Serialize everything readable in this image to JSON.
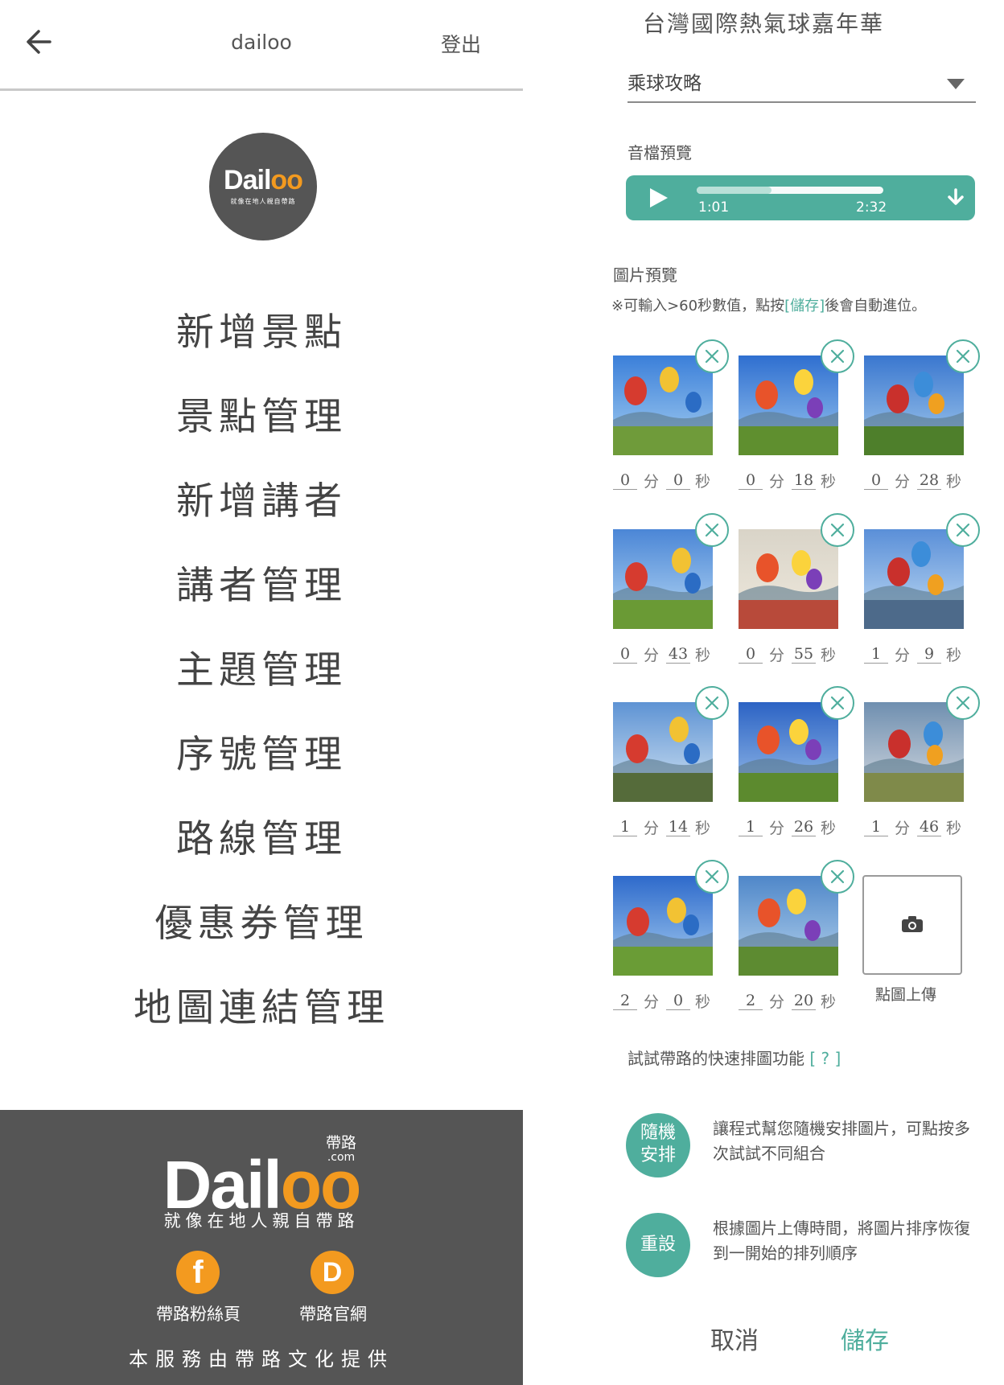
{
  "left_panel": {
    "title": "dailoo",
    "logout_label": "登出",
    "logo": {
      "brand_prefix": "Dail",
      "brand_suffix": "oo",
      "badge": "帶路 .com",
      "slogan": "就像在地人親自帶路"
    },
    "menu_items": [
      "新增景點",
      "景點管理",
      "新增講者",
      "講者管理",
      "主題管理",
      "序號管理",
      "路線管理",
      "優惠券管理",
      "地圖連結管理"
    ],
    "footer": {
      "brand_prefix": "Dail",
      "brand_suffix": "oo",
      "badge_top": "帶路",
      "badge_bottom": ".com",
      "slogan": "就像在地人親自帶路",
      "fanpage_label": "帶路粉絲頁",
      "website_label": "帶路官網",
      "credit": "本服務由帶路文化提供"
    }
  },
  "right_panel": {
    "title": "台灣國際熱氣球嘉年華",
    "select_value": "乘球攻略",
    "audio": {
      "label": "音檔預覽",
      "current_time": "1:01",
      "total_time": "2:32",
      "progress": 0.4
    },
    "images": {
      "label": "圖片預覽",
      "note_prefix": "※可輸入>60秒數值，點按",
      "note_highlight": "[儲存]",
      "note_suffix": "後會自動進位。",
      "minute_unit": "分",
      "second_unit": "秒",
      "items": [
        {
          "min": "0",
          "sec": "0"
        },
        {
          "min": "0",
          "sec": "18"
        },
        {
          "min": "0",
          "sec": "28"
        },
        {
          "min": "0",
          "sec": "43"
        },
        {
          "min": "0",
          "sec": "55"
        },
        {
          "min": "1",
          "sec": "9"
        },
        {
          "min": "1",
          "sec": "14"
        },
        {
          "min": "1",
          "sec": "26"
        },
        {
          "min": "1",
          "sec": "46"
        },
        {
          "min": "2",
          "sec": "0"
        },
        {
          "min": "2",
          "sec": "20"
        }
      ],
      "upload_label": "點圖上傳"
    },
    "quick_sort": {
      "hint": "試試帶路的快速排圖功能",
      "help": "[ ? ]",
      "random_line1": "隨機",
      "random_line2": "安排",
      "random_desc": "讓程式幫您隨機安排圖片，可點按多次試試不同組合",
      "reset_label": "重設",
      "reset_desc": "根據圖片上傳時間，將圖片排序恢復到一開始的排列順序"
    },
    "cancel_label": "取消",
    "save_label": "儲存"
  },
  "colors": {
    "accent": "#4fae9d",
    "brand_orange": "#f39a1f",
    "dark_gray": "#555555"
  }
}
